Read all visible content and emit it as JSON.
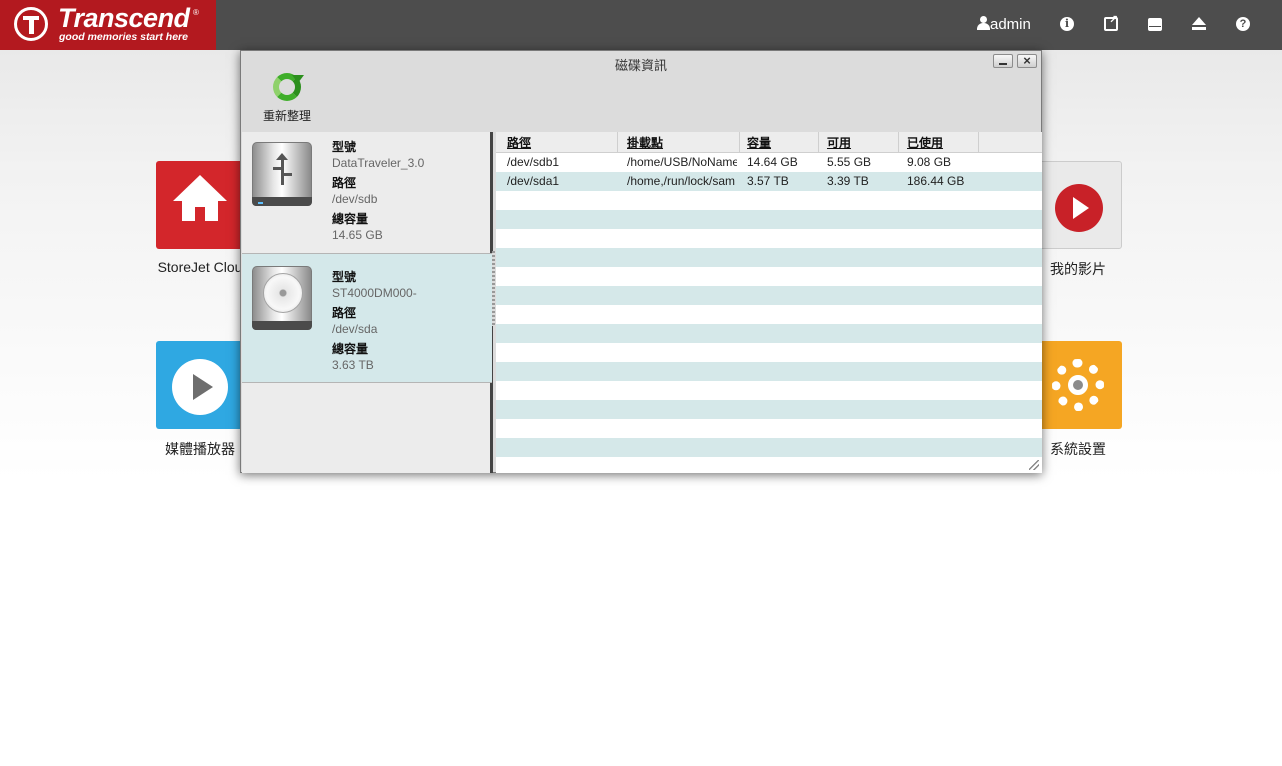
{
  "brand": {
    "name": "Transcend",
    "registered": "®",
    "tagline": "good memories start here",
    "color": "#b3191f"
  },
  "header": {
    "user": "admin",
    "icons": [
      "info-icon",
      "external-link-icon",
      "drive-icon",
      "eject-icon",
      "help-icon"
    ]
  },
  "desktop": {
    "apps": [
      {
        "label": "StoreJet Clou",
        "icon": "home-icon",
        "color": "#d3262b"
      },
      {
        "label": "媒體播放器",
        "icon": "play-icon",
        "color": "#2fa8e2"
      },
      {
        "label": "我的影片",
        "icon": "video-icon",
        "color": "#c82128"
      },
      {
        "label": "系統設置",
        "icon": "gear-icon",
        "color": "#f5a623"
      }
    ]
  },
  "dialog": {
    "title": "磁碟資訊",
    "toolbar": {
      "refresh_label": "重新整理"
    },
    "disks": [
      {
        "icon": "usb-drive-icon",
        "model_label": "型號",
        "model": "DataTraveler_3.0",
        "path_label": "路徑",
        "path": "/dev/sdb",
        "capacity_label": "總容量",
        "capacity": "14.65 GB"
      },
      {
        "icon": "hard-disk-icon",
        "model_label": "型號",
        "model": "ST4000DM000-",
        "path_label": "路徑",
        "path": "/dev/sda",
        "capacity_label": "總容量",
        "capacity": "3.63 TB"
      }
    ],
    "table": {
      "headers": [
        "路徑",
        "掛載點",
        "容量",
        "可用",
        "已使用"
      ],
      "rows": [
        [
          "/dev/sdb1",
          "/home/USB/NoName",
          "14.64 GB",
          "5.55 GB",
          "9.08 GB"
        ],
        [
          "/dev/sda1",
          "/home,/run/lock/sam",
          "3.57 TB",
          "3.39 TB",
          "186.44 GB"
        ]
      ]
    }
  }
}
